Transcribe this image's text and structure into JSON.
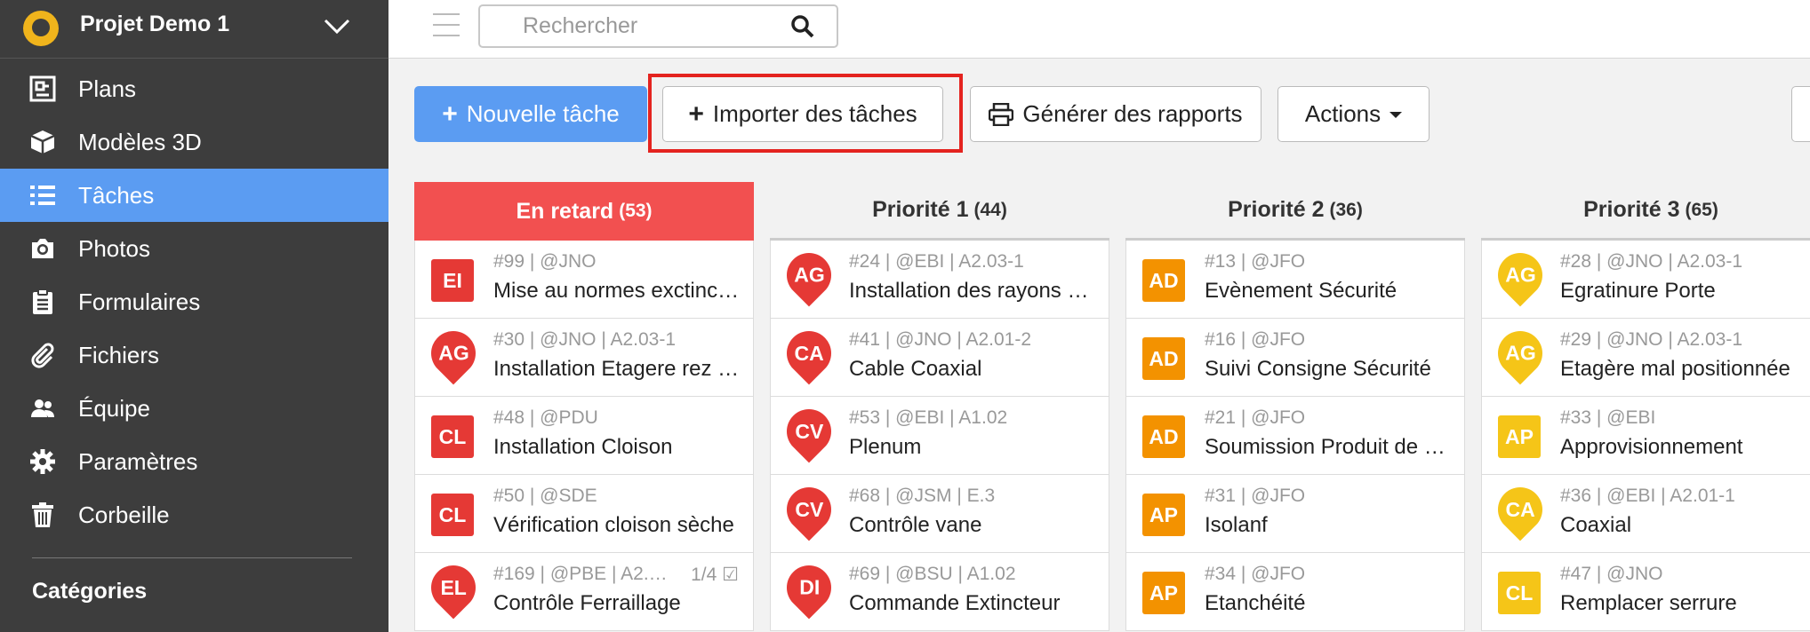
{
  "project": {
    "name": "Projet Demo 1"
  },
  "nav": [
    {
      "label": "Plans",
      "icon": "plan-icon",
      "active": false
    },
    {
      "label": "Modèles 3D",
      "icon": "cube-icon",
      "active": false
    },
    {
      "label": "Tâches",
      "icon": "list-icon",
      "active": true
    },
    {
      "label": "Photos",
      "icon": "camera-icon",
      "active": false
    },
    {
      "label": "Formulaires",
      "icon": "clipboard-icon",
      "active": false
    },
    {
      "label": "Fichiers",
      "icon": "paperclip-icon",
      "active": false
    },
    {
      "label": "Équipe",
      "icon": "team-icon",
      "active": false
    },
    {
      "label": "Paramètres",
      "icon": "gear-icon",
      "active": false
    },
    {
      "label": "Corbeille",
      "icon": "trash-icon",
      "active": false
    }
  ],
  "categories_label": "Catégories",
  "search": {
    "placeholder": "Rechercher"
  },
  "toolbar": {
    "new_task": "Nouvelle tâche",
    "import_tasks": "Importer des tâches",
    "generate_reports": "Générer des rapports",
    "actions": "Actions"
  },
  "columns": [
    {
      "title": "En retard",
      "count": "(53)",
      "late": true,
      "cards": [
        {
          "badge": "EI",
          "shape": "square",
          "color": "#e53935",
          "meta": "#99 | @JNO",
          "title": "Mise au normes exctinct…"
        },
        {
          "badge": "AG",
          "shape": "pin",
          "color": "#e53935",
          "meta": "#30 | @JNO | A2.03-1",
          "title": "Installation Etagere rez …"
        },
        {
          "badge": "CL",
          "shape": "square",
          "color": "#e53935",
          "meta": "#48 | @PDU",
          "title": "Installation Cloison"
        },
        {
          "badge": "CL",
          "shape": "square",
          "color": "#e53935",
          "meta": "#50 | @SDE",
          "title": "Vérification cloison sèche"
        },
        {
          "badge": "EL",
          "shape": "pin",
          "color": "#e53935",
          "meta": "#169 | @PBE | A2.…",
          "title": "Contrôle Ferraillage",
          "progress": "1/4"
        }
      ]
    },
    {
      "title": "Priorité 1",
      "count": "(44)",
      "late": false,
      "cards": [
        {
          "badge": "AG",
          "shape": "pin",
          "color": "#e53935",
          "meta": "#24 | @EBI | A2.03-1",
          "title": "Installation des rayons 1 …"
        },
        {
          "badge": "CA",
          "shape": "pin",
          "color": "#e53935",
          "meta": "#41 | @JNO | A2.01-2",
          "title": "Cable Coaxial"
        },
        {
          "badge": "CV",
          "shape": "pin",
          "color": "#e53935",
          "meta": "#53 | @EBI | A1.02",
          "title": "Plenum"
        },
        {
          "badge": "CV",
          "shape": "pin",
          "color": "#e53935",
          "meta": "#68 | @JSM | E.3",
          "title": "Contrôle vane"
        },
        {
          "badge": "DI",
          "shape": "pin",
          "color": "#e53935",
          "meta": "#69 | @BSU | A1.02",
          "title": "Commande Extincteur"
        }
      ]
    },
    {
      "title": "Priorité 2",
      "count": "(36)",
      "late": false,
      "cards": [
        {
          "badge": "AD",
          "shape": "square",
          "color": "#f39200",
          "meta": "#13 | @JFO",
          "title": "Evènement Sécurité"
        },
        {
          "badge": "AD",
          "shape": "square",
          "color": "#f39200",
          "meta": "#16 | @JFO",
          "title": "Suivi Consigne Sécurité"
        },
        {
          "badge": "AD",
          "shape": "square",
          "color": "#f39200",
          "meta": "#21 | @JFO",
          "title": "Soumission Produit de C…"
        },
        {
          "badge": "AP",
          "shape": "square",
          "color": "#f39200",
          "meta": "#31 | @JFO",
          "title": "Isolanf"
        },
        {
          "badge": "AP",
          "shape": "square",
          "color": "#f39200",
          "meta": "#34 | @JFO",
          "title": "Etanchéité"
        }
      ]
    },
    {
      "title": "Priorité 3",
      "count": "(65)",
      "late": false,
      "cards": [
        {
          "badge": "AG",
          "shape": "pin",
          "color": "#f5c518",
          "meta": "#28 | @JNO | A2.03-1",
          "title": "Egratinure Porte"
        },
        {
          "badge": "AG",
          "shape": "pin",
          "color": "#f5c518",
          "meta": "#29 | @JNO | A2.03-1",
          "title": "Etagère mal positionnée"
        },
        {
          "badge": "AP",
          "shape": "square",
          "color": "#f5c518",
          "meta": "#33 | @EBI",
          "title": "Approvisionnement"
        },
        {
          "badge": "CA",
          "shape": "pin",
          "color": "#f5c518",
          "meta": "#36 | @EBI | A2.01-1",
          "title": "Coaxial"
        },
        {
          "badge": "CL",
          "shape": "square",
          "color": "#f5c518",
          "meta": "#47 | @JNO",
          "title": "Remplacer serrure"
        }
      ]
    }
  ]
}
